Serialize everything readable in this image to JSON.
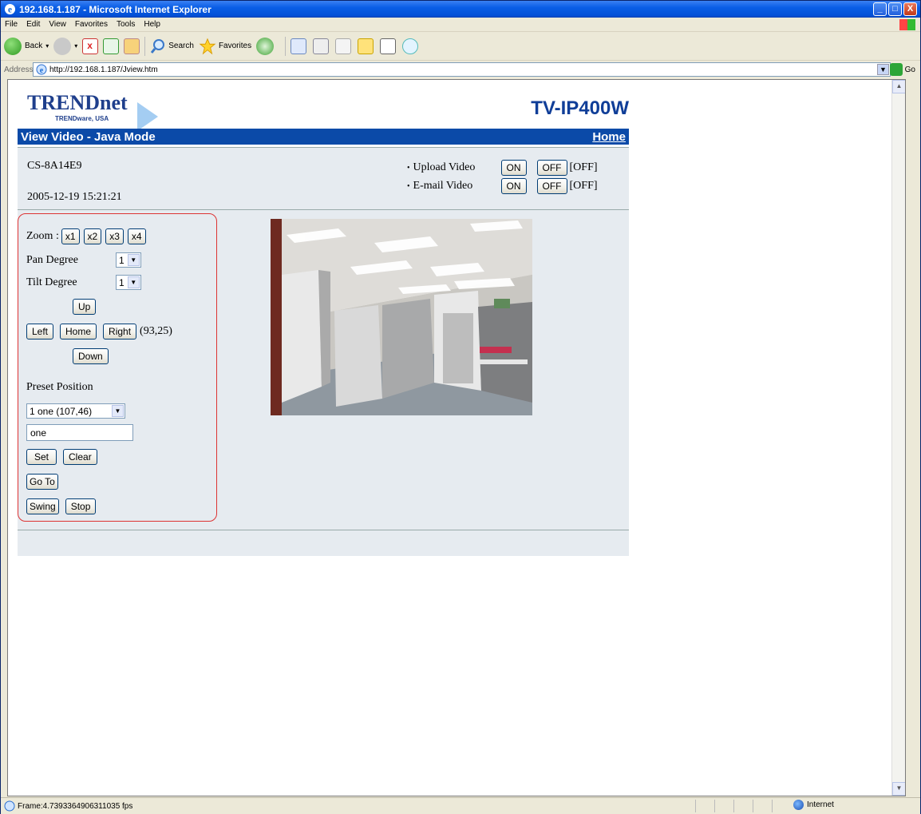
{
  "window": {
    "title": "192.168.1.187 - Microsoft Internet Explorer",
    "min_label": "_",
    "max_label": "□",
    "close_label": "X"
  },
  "menu": [
    "File",
    "Edit",
    "View",
    "Favorites",
    "Tools",
    "Help"
  ],
  "toolbar": {
    "back_label": "Back",
    "search_label": "Search",
    "favorites_label": "Favorites"
  },
  "address": {
    "label": "Address",
    "url": "http://192.168.1.187/Jview.htm",
    "go_label": "Go"
  },
  "page": {
    "logo_main": "TRENDnet",
    "logo_sub": "TRENDware, USA",
    "model": "TV-IP400W",
    "section_title": "View Video - Java Mode",
    "home_link": "Home",
    "device_id": "CS-8A14E9",
    "datetime": "2005-12-19 15:21:21",
    "upload": {
      "bullet": "•",
      "label": "Upload Video",
      "on": "ON",
      "off": "OFF",
      "state": "[OFF]"
    },
    "email": {
      "bullet": "•",
      "label": "E-mail Video",
      "on": "ON",
      "off": "OFF",
      "state": "[OFF]"
    }
  },
  "ptz": {
    "zoom_label": "Zoom :",
    "zoom_buttons": [
      "x1",
      "x2",
      "x3",
      "x4"
    ],
    "pan_label": "Pan Degree",
    "pan_value": "1",
    "tilt_label": "Tilt Degree",
    "tilt_value": "1",
    "up": "Up",
    "left": "Left",
    "home": "Home",
    "right": "Right",
    "position": "(93,25)",
    "down": "Down",
    "preset_label": "Preset Position",
    "preset_value": "1 one (107,46)",
    "preset_name": "one",
    "set": "Set",
    "clear": "Clear",
    "goto": "Go To",
    "swing": "Swing",
    "stop": "Stop"
  },
  "status": {
    "text": "Frame:4.7393364906311035 fps",
    "zone": "Internet"
  },
  "colors": {
    "brand_blue": "#0b4aa8",
    "panel_border": "#dd3333",
    "page_bg": "#e6ebf0"
  }
}
